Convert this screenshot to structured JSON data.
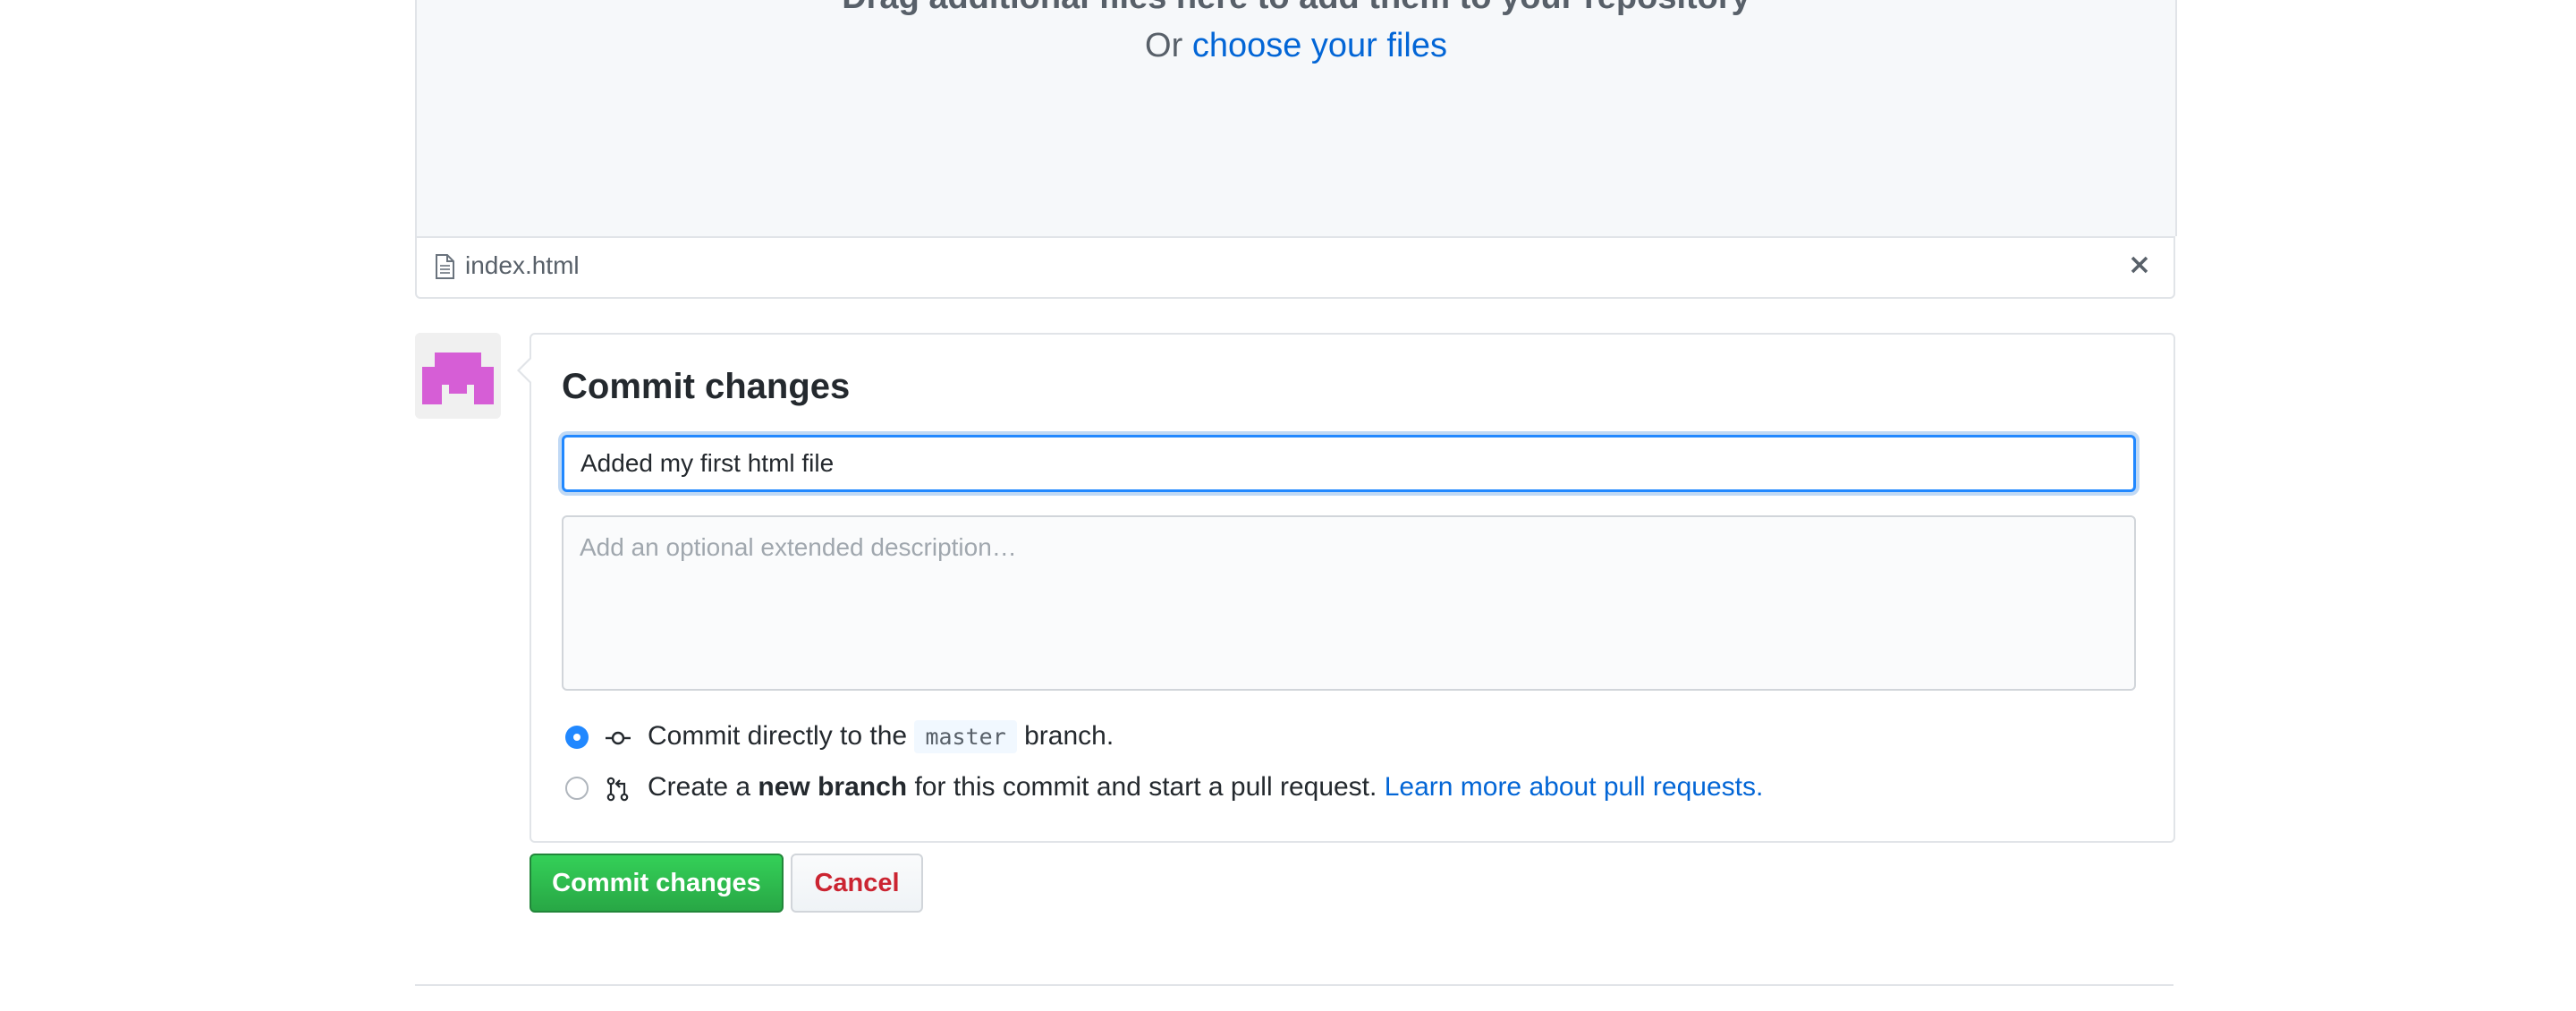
{
  "dropzone": {
    "heading": "Drag additional files here to add them to your repository",
    "or_text": "Or",
    "choose_link": "choose your files"
  },
  "file": {
    "name": "index.html",
    "icon": "file-icon",
    "close_icon": "close-icon"
  },
  "avatar": {
    "icon": "identicon-avatar",
    "color": "#d65ed6"
  },
  "commit": {
    "title": "Commit changes",
    "summary_value": "Added my first html file",
    "description_placeholder": "Add an optional extended description…",
    "option_direct": {
      "checked": true,
      "icon": "git-commit-icon",
      "text_before": "Commit directly to the",
      "branch": "master",
      "text_after": "branch."
    },
    "option_new_branch": {
      "checked": false,
      "icon": "git-pull-request-icon",
      "text_before": "Create a",
      "bold": "new branch",
      "text_after": "for this commit and start a pull request.",
      "link": "Learn more about pull requests."
    }
  },
  "buttons": {
    "commit": "Commit changes",
    "cancel": "Cancel"
  },
  "colors": {
    "link": "#0366d6",
    "primary_button": "#28a745",
    "danger_text": "#cb2431",
    "focus_border": "#2188ff"
  }
}
